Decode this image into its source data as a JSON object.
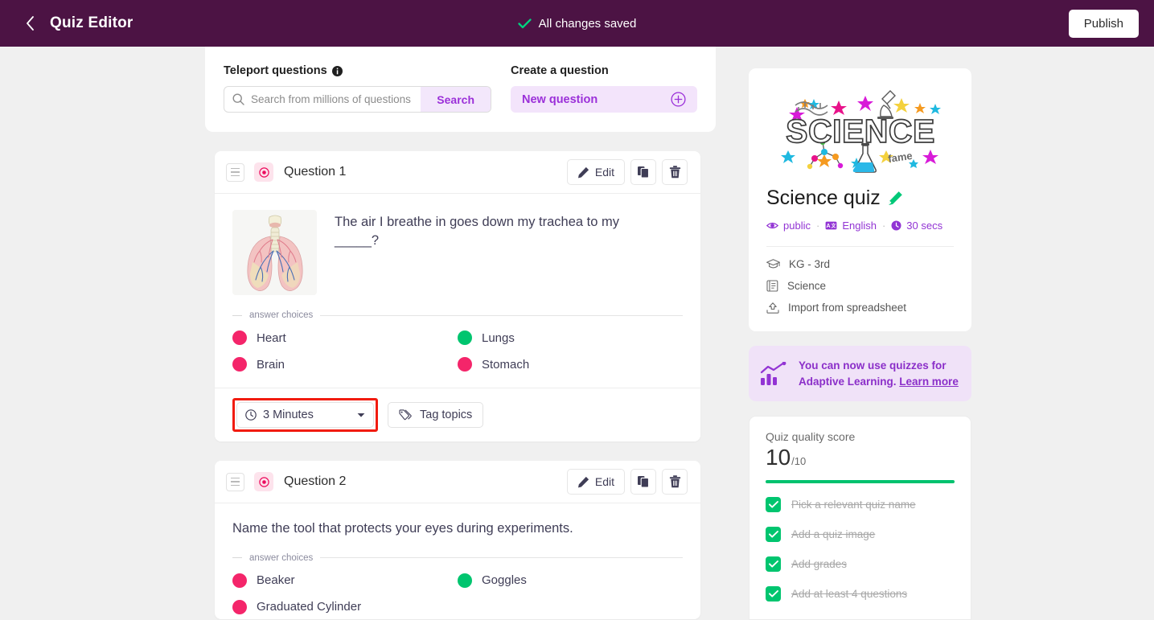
{
  "topbar": {
    "back_icon": "chevron-left-icon",
    "title": "Quiz Editor",
    "saved_text": "All changes saved",
    "saved_icon": "check-icon",
    "publish_label": "Publish",
    "bg_color": "#4c1344"
  },
  "teleport": {
    "label": "Teleport questions",
    "info_icon": "info-icon",
    "search_icon": "search-icon",
    "search_value": "",
    "search_placeholder": "Search from millions of questions",
    "search_button": "Search",
    "create_label": "Create a question",
    "new_question_label": "New question",
    "new_question_icon": "plus-circle-icon",
    "accent_color": "#9b30d9"
  },
  "questions": [
    {
      "drag_icon": "drag-handle-icon",
      "type_icon": "multiple-choice-icon",
      "title": "Question 1",
      "edit_label": "Edit",
      "edit_icon": "pencil-icon",
      "duplicate_icon": "copy-icon",
      "delete_icon": "trash-icon",
      "image_alt": "lungs-anatomy-image",
      "text": "The air I breathe in goes down my trachea to my _____?",
      "choices_label": "answer choices",
      "choices": [
        {
          "label": "Heart",
          "correct": false
        },
        {
          "label": "Lungs",
          "correct": true
        },
        {
          "label": "Brain",
          "correct": false
        },
        {
          "label": "Stomach",
          "correct": false
        }
      ],
      "time_icon": "clock-icon",
      "time_value": "3 Minutes",
      "time_highlighted": true,
      "tag_icon": "tag-icon",
      "tag_label": "Tag topics"
    },
    {
      "drag_icon": "drag-handle-icon",
      "type_icon": "multiple-choice-icon",
      "title": "Question 2",
      "edit_label": "Edit",
      "edit_icon": "pencil-icon",
      "duplicate_icon": "copy-icon",
      "delete_icon": "trash-icon",
      "text": "Name the tool that protects your eyes during experiments.",
      "choices_label": "answer choices",
      "choices": [
        {
          "label": "Beaker",
          "correct": false
        },
        {
          "label": "Goggles",
          "correct": true
        },
        {
          "label": "Graduated Cylinder",
          "correct": false
        }
      ]
    }
  ],
  "colors": {
    "correct": "#00c56f",
    "incorrect": "#f4256a",
    "highlight_box": "#f11b0f"
  },
  "sidebar": {
    "thumb_alt": "science-word-art-image",
    "quiz_name": "Science quiz",
    "edit_name_icon": "pencil-icon",
    "meta": [
      {
        "icon": "eye-icon",
        "label": "public"
      },
      {
        "icon": "language-icon",
        "label": "English"
      },
      {
        "icon": "clock-icon",
        "label": "30 secs"
      }
    ],
    "meta_separator": "·",
    "info_lines": [
      {
        "icon": "graduation-cap-icon",
        "label": "KG - 3rd"
      },
      {
        "icon": "book-icon",
        "label": "Science"
      },
      {
        "icon": "upload-icon",
        "label": "Import from spreadsheet"
      }
    ],
    "promo": {
      "icon": "bar-chart-icon",
      "line1": "You can now use quizzes for",
      "line2": "Adaptive Learning.",
      "link": "Learn more"
    },
    "quality": {
      "title": "Quiz quality score",
      "score": "10",
      "score_suffix": "/10",
      "progress_percent": 100,
      "items": [
        {
          "label": "Pick a relevant quiz name",
          "done": true
        },
        {
          "label": "Add a quiz image",
          "done": true
        },
        {
          "label": "Add grades",
          "done": true
        },
        {
          "label": "Add at least 4 questions",
          "done": true
        }
      ]
    }
  }
}
